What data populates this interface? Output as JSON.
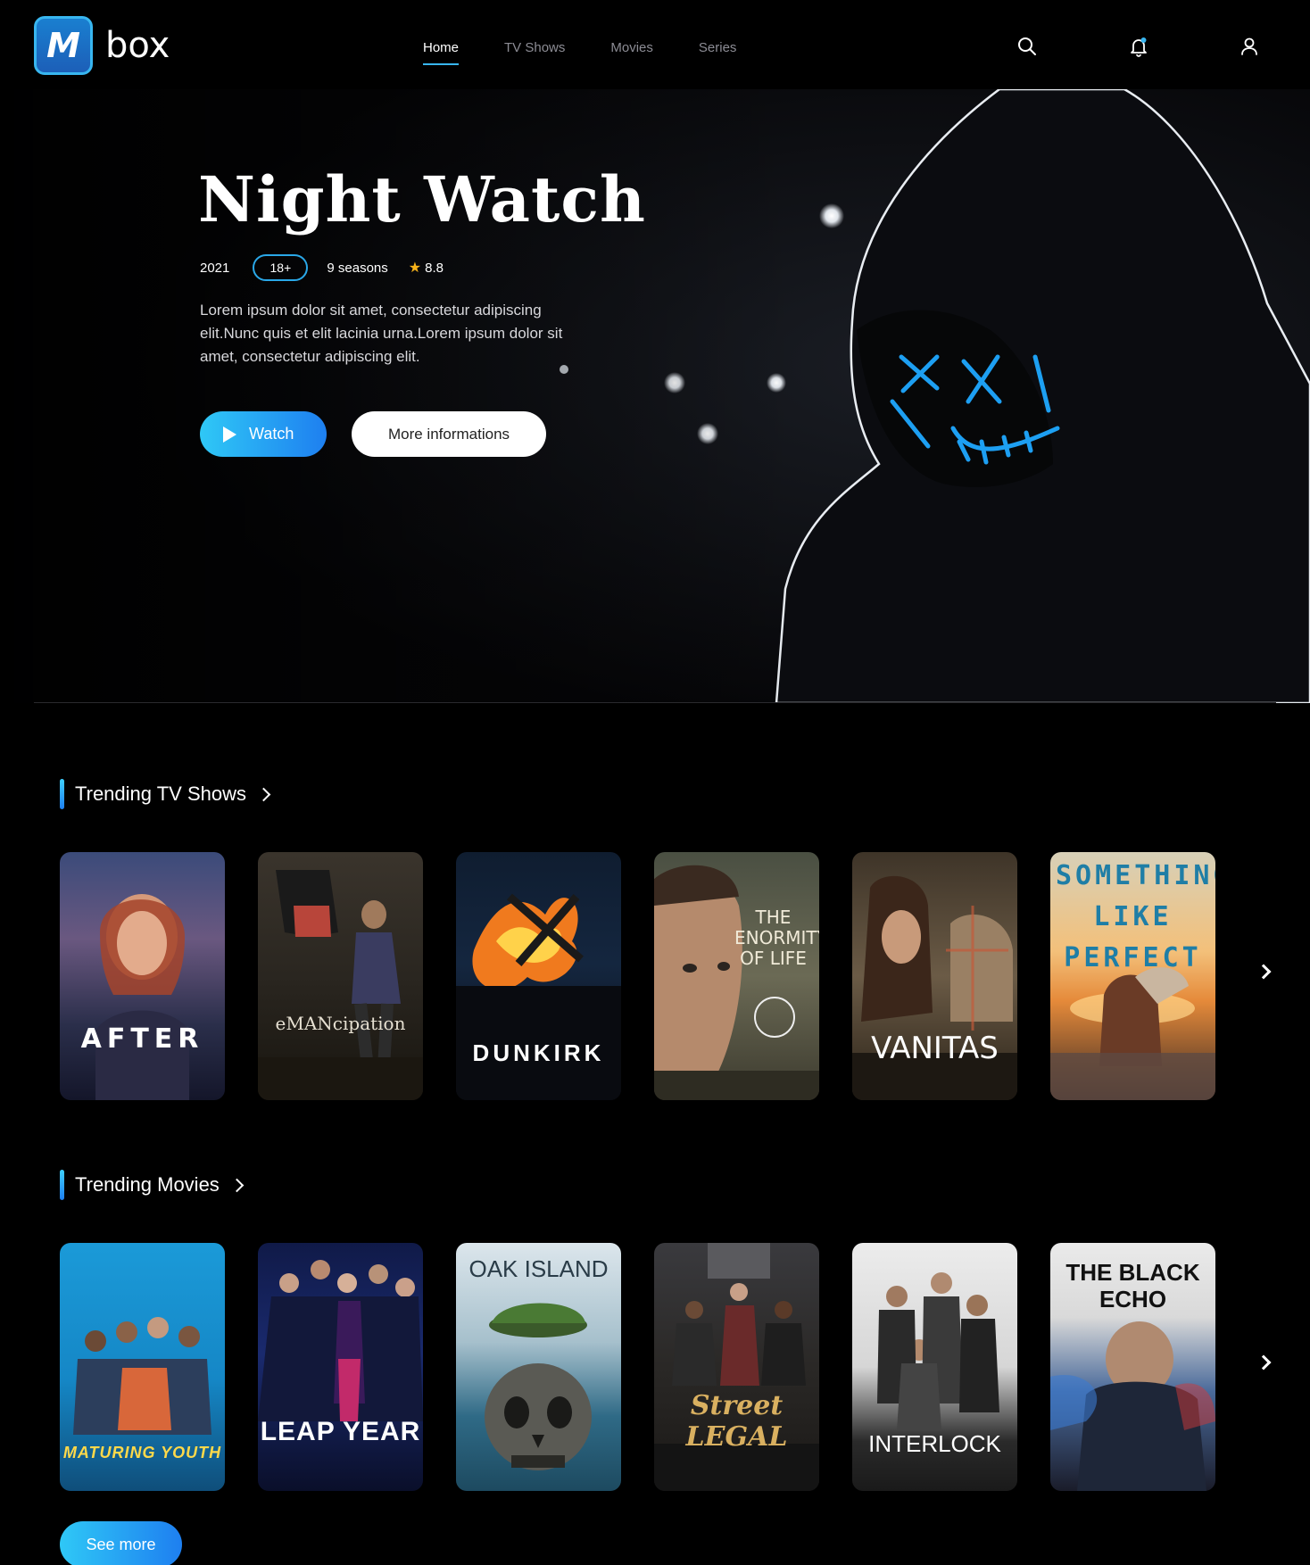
{
  "brand": {
    "logo_letter": "M",
    "name": "box"
  },
  "nav": [
    {
      "label": "Home",
      "active": true
    },
    {
      "label": "TV Shows",
      "active": false
    },
    {
      "label": "Movies",
      "active": false
    },
    {
      "label": "Series",
      "active": false
    }
  ],
  "header_icons": [
    "search-icon",
    "bell-icon",
    "user-icon"
  ],
  "hero": {
    "title": "Night Watch",
    "year": "2021",
    "rating_badge": "18+",
    "seasons": "9 seasons",
    "star": "★",
    "score": "8.8",
    "description": "Lorem ipsum dolor sit amet, consectetur adipiscing elit.Nunc quis et elit lacinia urna.Lorem ipsum dolor sit amet, consectetur adipiscing elit.",
    "watch_label": "Watch",
    "more_label": "More informations"
  },
  "sections": {
    "tv": {
      "title": "Trending TV Shows",
      "posters": [
        "AFTER",
        "eMANcipation",
        "DUNKIRK",
        "THE ENORMITY OF LIFE",
        "VANITAS",
        "SOMETHING LIKE PERFECT"
      ]
    },
    "movies": {
      "title": "Trending Movies",
      "posters": [
        "MATURING YOUTH",
        "LEAP YEAR",
        "OAK ISLAND",
        "Street LEGAL",
        "INTERLOCK",
        "THE BLACK ECHO"
      ]
    }
  },
  "see_more_label": "See more",
  "colors": {
    "accent": "#38b6f0",
    "accent_dark": "#1e7ff0",
    "star": "#f6b21a",
    "background": "#000000"
  }
}
